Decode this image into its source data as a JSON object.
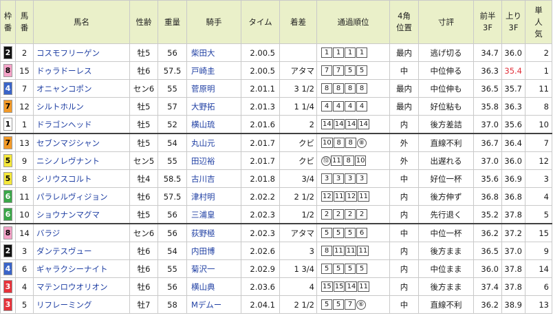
{
  "headers": {
    "gate": "枠番",
    "num": "馬番",
    "name": "馬名",
    "sexage": "性齢",
    "weight": "重量",
    "jockey": "騎手",
    "time": "タイム",
    "margin": "着差",
    "passing": "通過順位",
    "corner4": "4角位置",
    "comment": "寸評",
    "first3f": "前半3F",
    "last3f": "上り3F",
    "pop": "単人気"
  },
  "gate_colors": {
    "1": {
      "bg": "#ffffff",
      "fg": "#000000"
    },
    "2": {
      "bg": "#111111",
      "fg": "#ffffff"
    },
    "3": {
      "bg": "#e6323a",
      "fg": "#ffffff"
    },
    "4": {
      "bg": "#3a64c8",
      "fg": "#ffffff"
    },
    "5": {
      "bg": "#f5e83c",
      "fg": "#000000"
    },
    "6": {
      "bg": "#3aa648",
      "fg": "#ffffff"
    },
    "7": {
      "bg": "#f39a28",
      "fg": "#000000"
    },
    "8": {
      "bg": "#f5a3c8",
      "fg": "#000000"
    }
  },
  "rows": [
    {
      "gate": "2",
      "num": "2",
      "name": "コスモフリーゲン",
      "sexage": "牡5",
      "weight": "56",
      "jockey": "柴田大",
      "time": "2.00.5",
      "margin": "",
      "passing": [
        "1",
        "1",
        "1",
        "1"
      ],
      "circled": "",
      "corner4": "最内",
      "comment": "逃げ切る",
      "f3": "34.7",
      "l3": "36.0",
      "l3red": false,
      "pop": "2"
    },
    {
      "gate": "8",
      "num": "15",
      "name": "ドゥラドーレス",
      "sexage": "牡6",
      "weight": "57.5",
      "jockey": "戸崎圭",
      "time": "2.00.5",
      "margin": "アタマ",
      "passing": [
        "7",
        "7",
        "5",
        "5"
      ],
      "circled": "",
      "corner4": "中",
      "comment": "中位伸る",
      "f3": "36.3",
      "l3": "35.4",
      "l3red": true,
      "pop": "1"
    },
    {
      "gate": "4",
      "num": "7",
      "name": "オニャンコポン",
      "sexage": "セン6",
      "weight": "55",
      "jockey": "菅原明",
      "time": "2.01.1",
      "margin": "3 1/2",
      "passing": [
        "8",
        "8",
        "8",
        "8"
      ],
      "circled": "",
      "corner4": "最内",
      "comment": "中位伸も",
      "f3": "36.5",
      "l3": "35.7",
      "l3red": false,
      "pop": "11"
    },
    {
      "gate": "7",
      "num": "12",
      "name": "シルトホルン",
      "sexage": "牡5",
      "weight": "57",
      "jockey": "大野拓",
      "time": "2.01.3",
      "margin": "1 1/4",
      "passing": [
        "4",
        "4",
        "4",
        "4"
      ],
      "circled": "",
      "corner4": "最内",
      "comment": "好位粘も",
      "f3": "35.8",
      "l3": "36.3",
      "l3red": false,
      "pop": "8"
    },
    {
      "gate": "1",
      "num": "1",
      "name": "ドラゴンヘッド",
      "sexage": "牡5",
      "weight": "52",
      "jockey": "横山琉",
      "time": "2.01.6",
      "margin": "2",
      "passing": [
        "14",
        "14",
        "14",
        "14"
      ],
      "circled": "",
      "corner4": "内",
      "comment": "後方差詰",
      "f3": "37.0",
      "l3": "35.6",
      "l3red": false,
      "pop": "10"
    },
    {
      "gate": "7",
      "num": "13",
      "name": "セブンマジシャン",
      "sexage": "牡5",
      "weight": "54",
      "jockey": "丸山元",
      "time": "2.01.7",
      "margin": "クビ",
      "passing": [
        "10",
        "8",
        "8"
      ],
      "circled": "⑧",
      "corner4": "外",
      "comment": "直線不利",
      "f3": "36.7",
      "l3": "36.4",
      "l3red": false,
      "pop": "7",
      "group": true
    },
    {
      "gate": "5",
      "num": "9",
      "name": "ニシノレヴナント",
      "sexage": "セン5",
      "weight": "55",
      "jockey": "田辺裕",
      "time": "2.01.7",
      "margin": "クビ",
      "passing": [
        "11",
        "8",
        "10"
      ],
      "circled": "⑬",
      "circledFirst": true,
      "corner4": "外",
      "comment": "出遅れる",
      "f3": "37.0",
      "l3": "36.0",
      "l3red": false,
      "pop": "12"
    },
    {
      "gate": "5",
      "num": "8",
      "name": "シリウスコルト",
      "sexage": "牡4",
      "weight": "58.5",
      "jockey": "古川吉",
      "time": "2.01.8",
      "margin": "3/4",
      "passing": [
        "3",
        "3",
        "3",
        "3"
      ],
      "circled": "",
      "corner4": "中",
      "comment": "好位一杯",
      "f3": "35.6",
      "l3": "36.9",
      "l3red": false,
      "pop": "3"
    },
    {
      "gate": "6",
      "num": "11",
      "name": "パラレルヴィジョン",
      "sexage": "牡6",
      "weight": "57.5",
      "jockey": "津村明",
      "time": "2.02.2",
      "margin": "2 1/2",
      "passing": [
        "12",
        "11",
        "12",
        "11"
      ],
      "circled": "",
      "corner4": "内",
      "comment": "後方伸ず",
      "f3": "36.8",
      "l3": "36.8",
      "l3red": false,
      "pop": "4"
    },
    {
      "gate": "6",
      "num": "10",
      "name": "ショウナンマグマ",
      "sexage": "牡5",
      "weight": "56",
      "jockey": "三浦皇",
      "time": "2.02.3",
      "margin": "1/2",
      "passing": [
        "2",
        "2",
        "2",
        "2"
      ],
      "circled": "",
      "corner4": "内",
      "comment": "先行退く",
      "f3": "35.2",
      "l3": "37.8",
      "l3red": false,
      "pop": "5"
    },
    {
      "gate": "8",
      "num": "14",
      "name": "バラジ",
      "sexage": "セン6",
      "weight": "56",
      "jockey": "荻野極",
      "time": "2.02.3",
      "margin": "アタマ",
      "passing": [
        "5",
        "5",
        "5",
        "6"
      ],
      "circled": "",
      "corner4": "中",
      "comment": "中位一杯",
      "f3": "36.2",
      "l3": "37.2",
      "l3red": false,
      "pop": "15",
      "group": true
    },
    {
      "gate": "2",
      "num": "3",
      "name": "ダンテスヴュー",
      "sexage": "牡6",
      "weight": "54",
      "jockey": "内田博",
      "time": "2.02.6",
      "margin": "3",
      "passing": [
        "8",
        "11",
        "11",
        "11"
      ],
      "circled": "",
      "corner4": "内",
      "comment": "後方まま",
      "f3": "36.5",
      "l3": "37.0",
      "l3red": false,
      "pop": "9"
    },
    {
      "gate": "4",
      "num": "6",
      "name": "ギャラクシーナイト",
      "sexage": "牡6",
      "weight": "55",
      "jockey": "菊沢一",
      "time": "2.02.9",
      "margin": "1 3/4",
      "passing": [
        "5",
        "5",
        "5",
        "5"
      ],
      "circled": "",
      "corner4": "内",
      "comment": "中位まま",
      "f3": "36.0",
      "l3": "37.8",
      "l3red": false,
      "pop": "14"
    },
    {
      "gate": "3",
      "num": "4",
      "name": "マテンロウオリオン",
      "sexage": "牡6",
      "weight": "56",
      "jockey": "横山典",
      "time": "2.03.6",
      "margin": "4",
      "passing": [
        "15",
        "15",
        "14",
        "11"
      ],
      "circled": "",
      "corner4": "内",
      "comment": "後方まま",
      "f3": "37.4",
      "l3": "37.8",
      "l3red": false,
      "pop": "6"
    },
    {
      "gate": "3",
      "num": "5",
      "name": "リフレーミング",
      "sexage": "牡7",
      "weight": "58",
      "jockey": "Mデムー",
      "time": "2.04.1",
      "margin": "2 1/2",
      "passing": [
        "5",
        "5",
        "7"
      ],
      "circled": "⑥",
      "corner4": "中",
      "comment": "直線不利",
      "f3": "36.2",
      "l3": "38.9",
      "l3red": false,
      "pop": "13"
    }
  ]
}
